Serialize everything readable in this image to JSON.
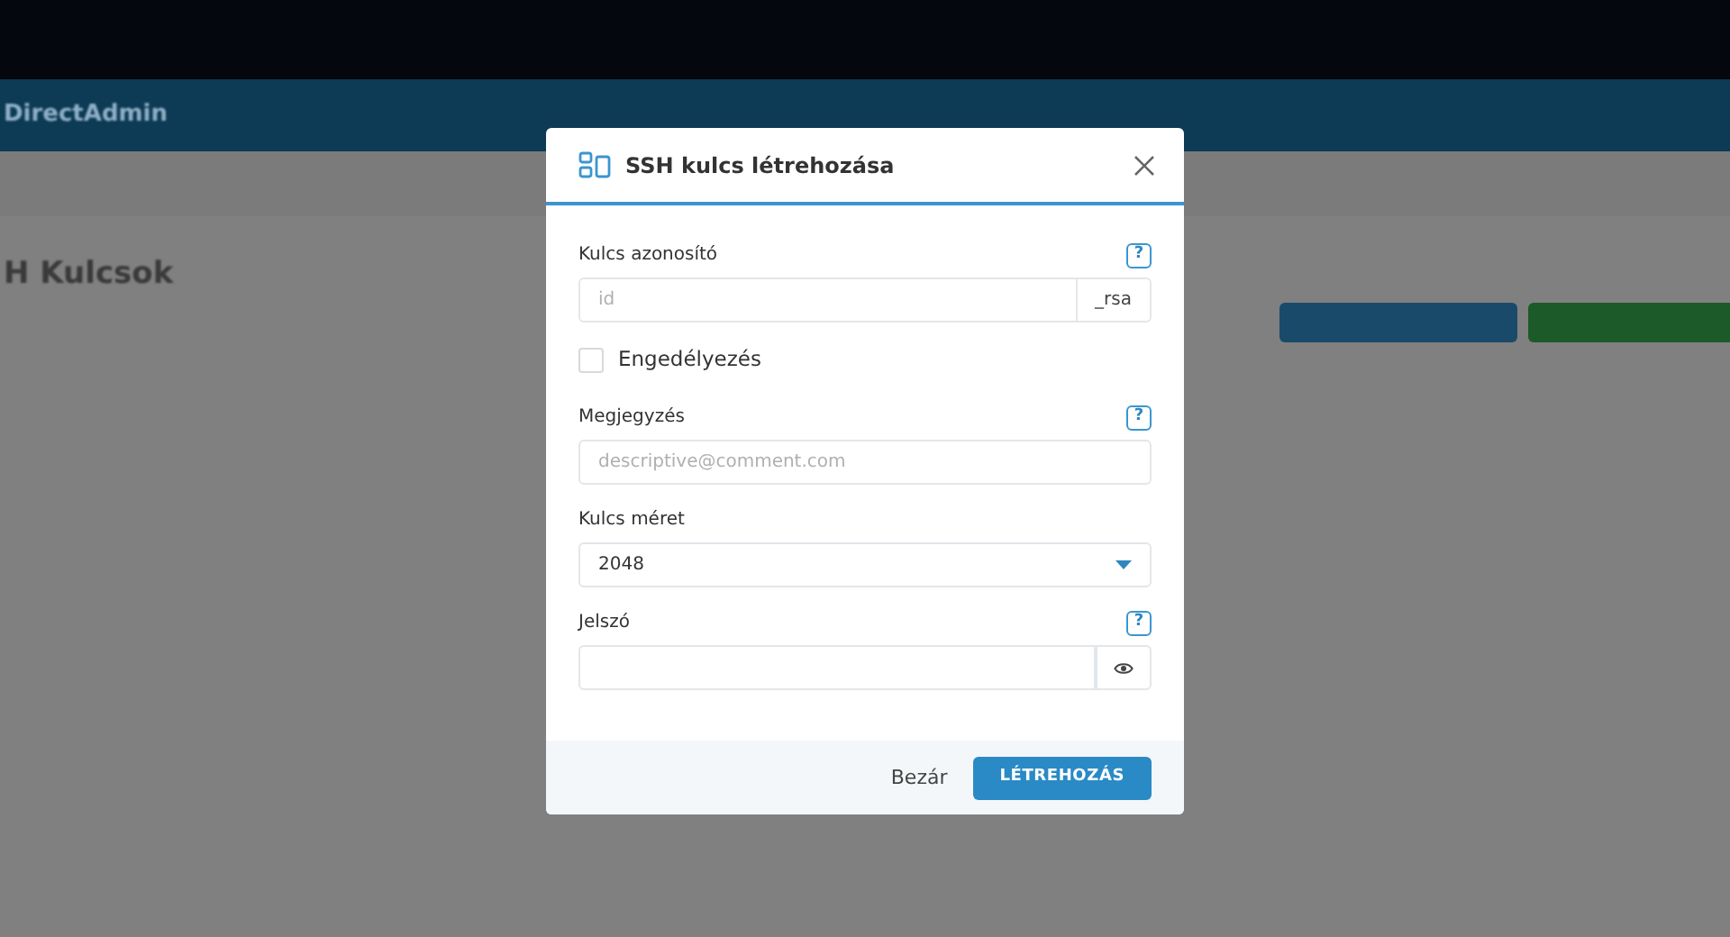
{
  "background": {
    "logo": "DirectAdmin",
    "page_title": "H Kulcsok"
  },
  "modal": {
    "title": "SSH kulcs létrehozása",
    "fields": [
      {
        "kind": "text-addon",
        "label": "Kulcs azonosító",
        "help": "?",
        "placeholder": "id",
        "addon": "_rsa"
      },
      {
        "kind": "checkbox",
        "label": "Engedélyezés",
        "checked": false
      },
      {
        "kind": "text",
        "label": "Megjegyzés",
        "help": "?",
        "placeholder": "descriptive@comment.com"
      },
      {
        "kind": "select",
        "label": "Kulcs méret",
        "value": "2048"
      },
      {
        "kind": "password",
        "label": "Jelszó",
        "help": "?"
      }
    ],
    "buttons": [
      {
        "kind": "link",
        "label": "Bezár"
      },
      {
        "kind": "primary",
        "label": "LÉTREHOZÁS"
      }
    ]
  }
}
